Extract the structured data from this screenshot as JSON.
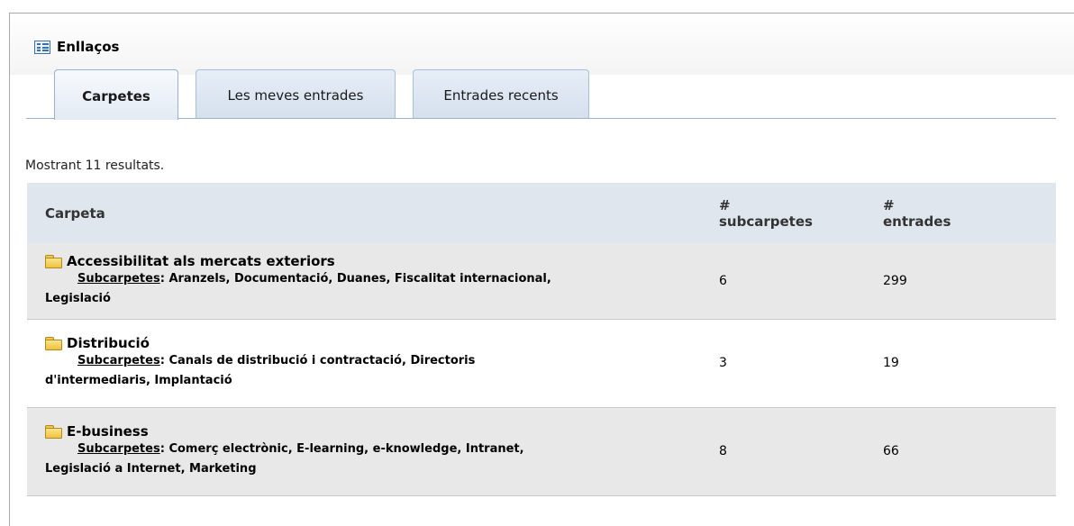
{
  "portlet": {
    "title": "Enllaços"
  },
  "tabs": [
    {
      "label": "Carpetes",
      "active": true
    },
    {
      "label": "Les meves entrades",
      "active": false
    },
    {
      "label": "Entrades recents",
      "active": false
    }
  ],
  "results_text": "Mostrant 11 resultats.",
  "table": {
    "headers": {
      "folder": "Carpeta",
      "subfolders_hash": "#",
      "subfolders": "subcarpetes",
      "entries_hash": "#",
      "entries": "entrades"
    },
    "subfolders_label": "Subcarpetes",
    "rows": [
      {
        "name": "Accessibilitat als mercats exteriors",
        "subfolders_line1": "Aranzels, Documentació, Duanes, Fiscalitat internacional,",
        "subfolders_line2": "Legislació",
        "subfolder_count": "6",
        "entry_count": "299"
      },
      {
        "name": "Distribució",
        "subfolders_line1": "Canals de distribució i contractació, Directoris",
        "subfolders_line2": "d'intermediaris, Implantació",
        "subfolder_count": "3",
        "entry_count": "19"
      },
      {
        "name": "E-business",
        "subfolders_line1": "Comerç electrònic, E-learning, e-knowledge, Intranet,",
        "subfolders_line2": "Legislació a Internet, Marketing",
        "subfolder_count": "8",
        "entry_count": "66"
      }
    ]
  }
}
